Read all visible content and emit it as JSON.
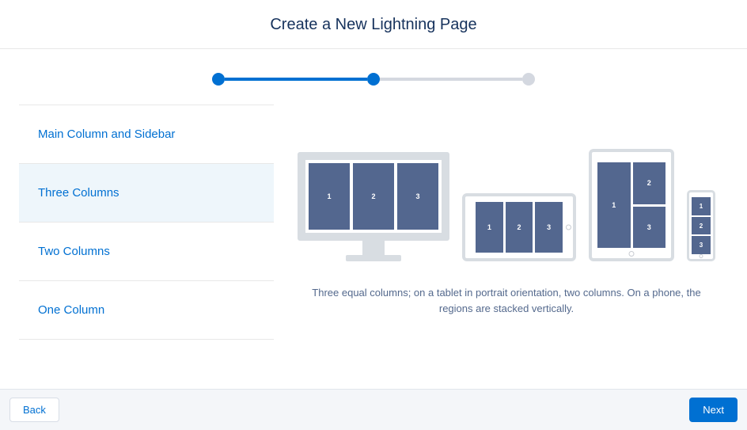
{
  "header": {
    "title": "Create a New Lightning Page"
  },
  "progress": {
    "current": 2,
    "total": 3
  },
  "templates": {
    "items": [
      {
        "label": "Main Column and Sidebar"
      },
      {
        "label": "Three Columns"
      },
      {
        "label": "Two Columns"
      },
      {
        "label": "One Column"
      }
    ],
    "selected": 1
  },
  "preview": {
    "description": "Three equal columns; on a tablet in portrait orientation, two columns. On a phone, the regions are stacked vertically.",
    "regions": {
      "r1": "1",
      "r2": "2",
      "r3": "3"
    }
  },
  "footer": {
    "back_label": "Back",
    "next_label": "Next"
  }
}
